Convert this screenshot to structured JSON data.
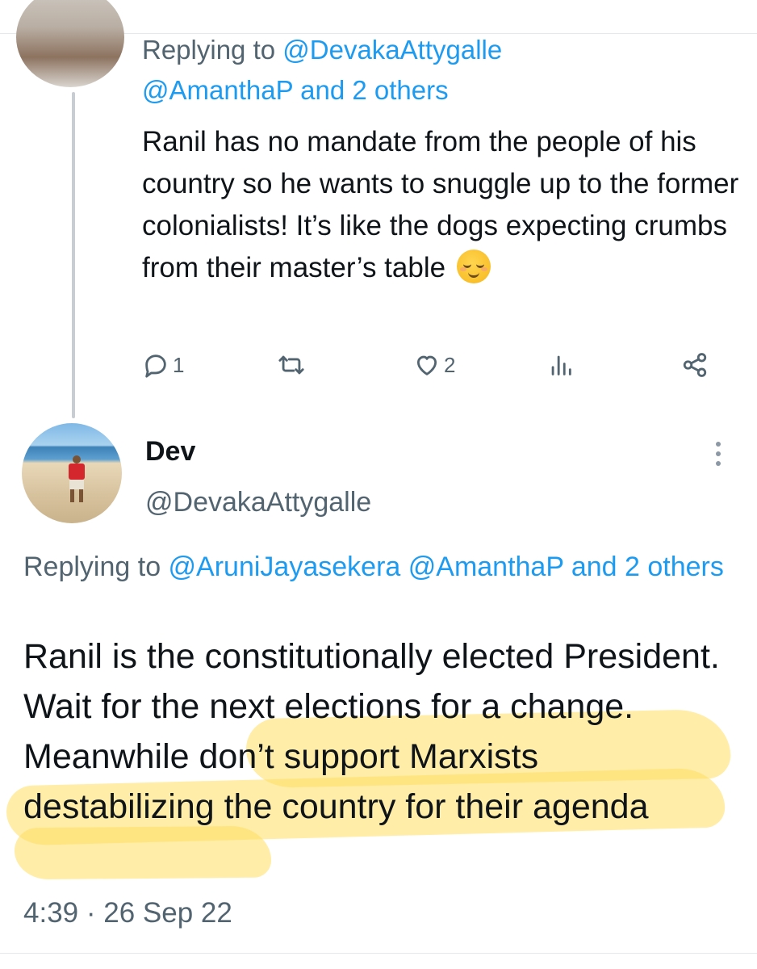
{
  "previous_tweet": {
    "reply_prefix": "Replying to ",
    "reply_mention_1": "@DevakaAttygalle",
    "reply_mention_2": "@AmanthaP and 2 others",
    "body": "Ranil has no mandate from the people of his country so he wants to snuggle up to the former colonialists! It’s like the dogs expecting crumbs from their master’s table",
    "emoji": "relieved-face",
    "actions": {
      "reply_count": "1",
      "like_count": "2"
    }
  },
  "main_tweet": {
    "display_name": "Dev",
    "handle": "@DevakaAttygalle",
    "reply_prefix": "Replying to ",
    "reply_mentions": "@AruniJayasekera @AmanthaP and 2 others",
    "body": "Ranil is the constitutionally elected President. Wait for the next elections for a change. Meanwhile don’t support Marxists destabilizing the country for their agenda",
    "timestamp": "4:39 · 26 Sep 22"
  },
  "colors": {
    "accent": "#1d9bf0",
    "secondary_text": "#536471",
    "highlight": "#ffde60"
  },
  "icons": [
    "reply-icon",
    "retweet-icon",
    "like-icon",
    "analytics-icon",
    "share-icon",
    "more-icon"
  ]
}
